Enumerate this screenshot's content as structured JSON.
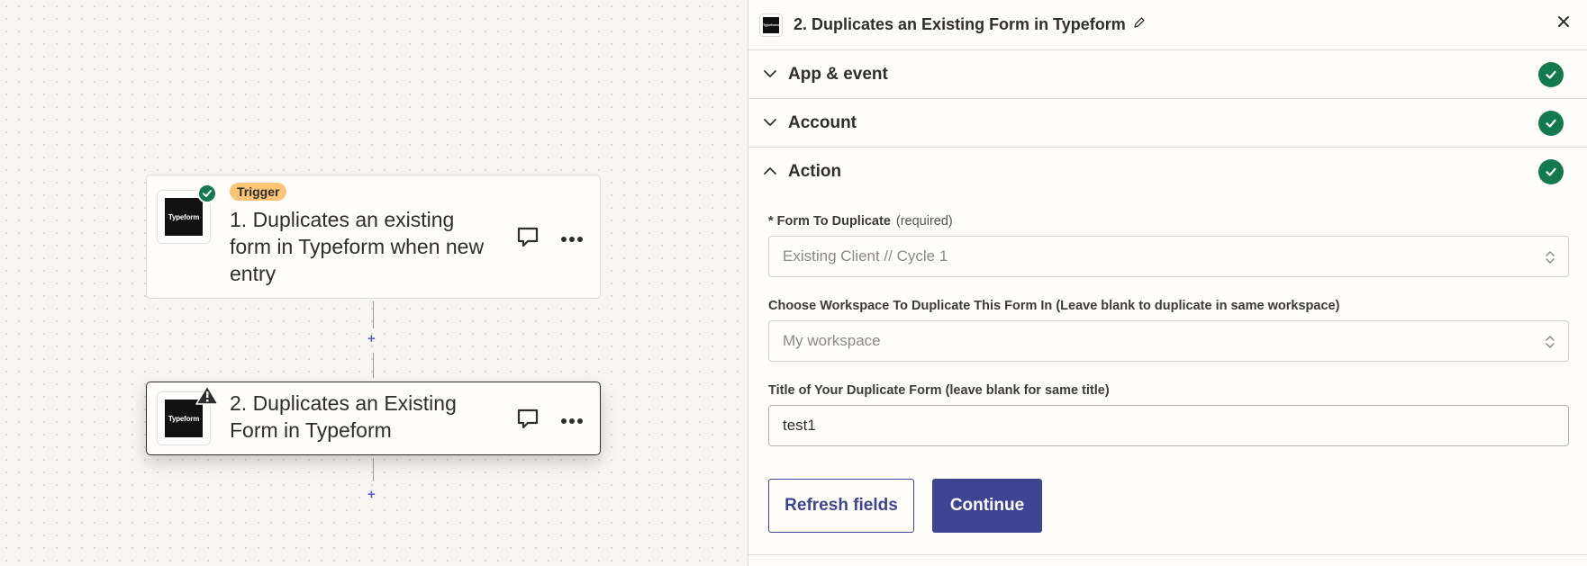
{
  "canvas": {
    "steps": [
      {
        "tag": "Trigger",
        "title": "1. Duplicates an existing form in Typeform when new entry",
        "logo_text": "Typeform",
        "status": "complete"
      },
      {
        "title": "2. Duplicates an Existing Form in Typeform",
        "logo_text": "Typeform",
        "status": "warning"
      }
    ],
    "plus_label": "+"
  },
  "panel": {
    "title": "2. Duplicates an Existing Form in Typeform",
    "logo_text": "Typeform",
    "sections": [
      {
        "label": "App & event",
        "status": "complete"
      },
      {
        "label": "Account",
        "status": "complete"
      },
      {
        "label": "Action",
        "status": "complete"
      }
    ],
    "fields": {
      "form_to_duplicate": {
        "label": "* Form To Duplicate",
        "required_note": "(required)",
        "value": "Existing Client // Cycle 1"
      },
      "workspace": {
        "label": "Choose Workspace To Duplicate This Form In (Leave blank to duplicate in same workspace)",
        "value": "My workspace"
      },
      "title": {
        "label": "Title of Your Duplicate Form (leave blank for same title)",
        "value": "test1"
      }
    },
    "buttons": {
      "refresh": "Refresh fields",
      "continue": "Continue"
    }
  },
  "colors": {
    "accent": "#3d4592",
    "success": "#127a4d",
    "trigger_tag": "#fdc476"
  }
}
